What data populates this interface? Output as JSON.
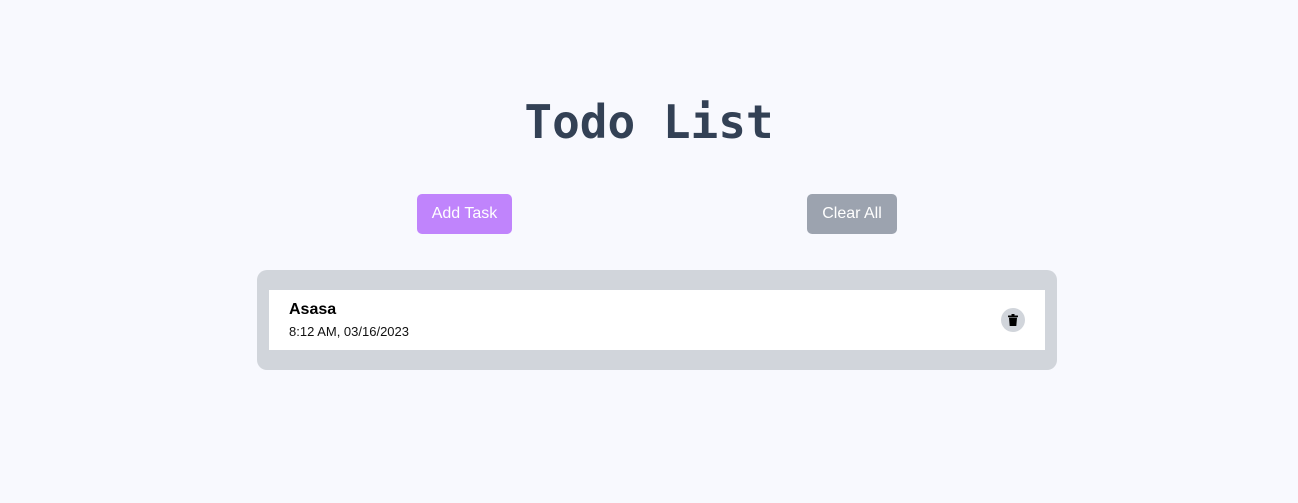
{
  "page": {
    "title": "Todo List"
  },
  "toolbar": {
    "add_label": "Add Task",
    "clear_label": "Clear All"
  },
  "tasks": [
    {
      "name": "Asasa",
      "time": "8:12 AM, 03/16/2023",
      "delete_icon": "trash-icon"
    }
  ],
  "colors": {
    "background": "#f8f9fe",
    "title": "#334155",
    "add_button": "#c084fc",
    "clear_button": "#9ca3af",
    "list_panel": "#d1d5db",
    "task_card": "#ffffff"
  }
}
